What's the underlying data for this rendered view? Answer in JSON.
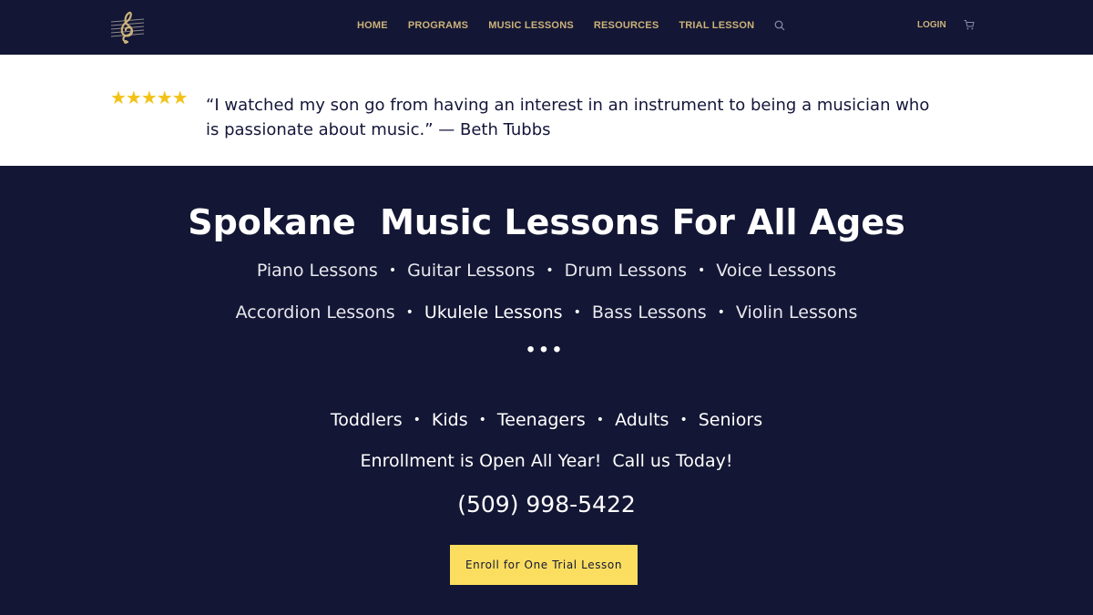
{
  "header": {
    "nav": [
      "HOME",
      "PROGRAMS",
      "MUSIC LESSONS",
      "RESOURCES",
      "TRIAL LESSON"
    ],
    "login": "LOGIN",
    "accent_color": "#cbb27a",
    "icons": [
      "treble-clef-logo",
      "search-icon",
      "cart-icon"
    ]
  },
  "testimonial": {
    "stars": "★★★★★",
    "rating": 5,
    "quote": "“I watched my son go from having an interest in an instrument to being a musician who is passionate about music.” — Beth Tubbs",
    "star_color": "#f2c217"
  },
  "hero": {
    "title": "Spokane  Music Lessons For All Ages",
    "lessons_row1": [
      "Piano Lessons",
      "Guitar Lessons",
      "Drum Lessons",
      "Voice Lessons"
    ],
    "lessons_row2": [
      "Accordion Lessons",
      "Ukulele Lessons",
      "Bass Lessons",
      "Violin Lessons"
    ],
    "bullet": "•",
    "dots": "•••",
    "ages": [
      "Toddlers",
      "Kids",
      "Teenagers",
      "Adults",
      "Seniors"
    ],
    "enrollment": "Enrollment is Open All Year!  Call us Today!",
    "phone": "(509) 998-5422",
    "cta": "Enroll for One Trial Lesson",
    "background_color": "#131634",
    "cta_color": "#fbde5f"
  }
}
